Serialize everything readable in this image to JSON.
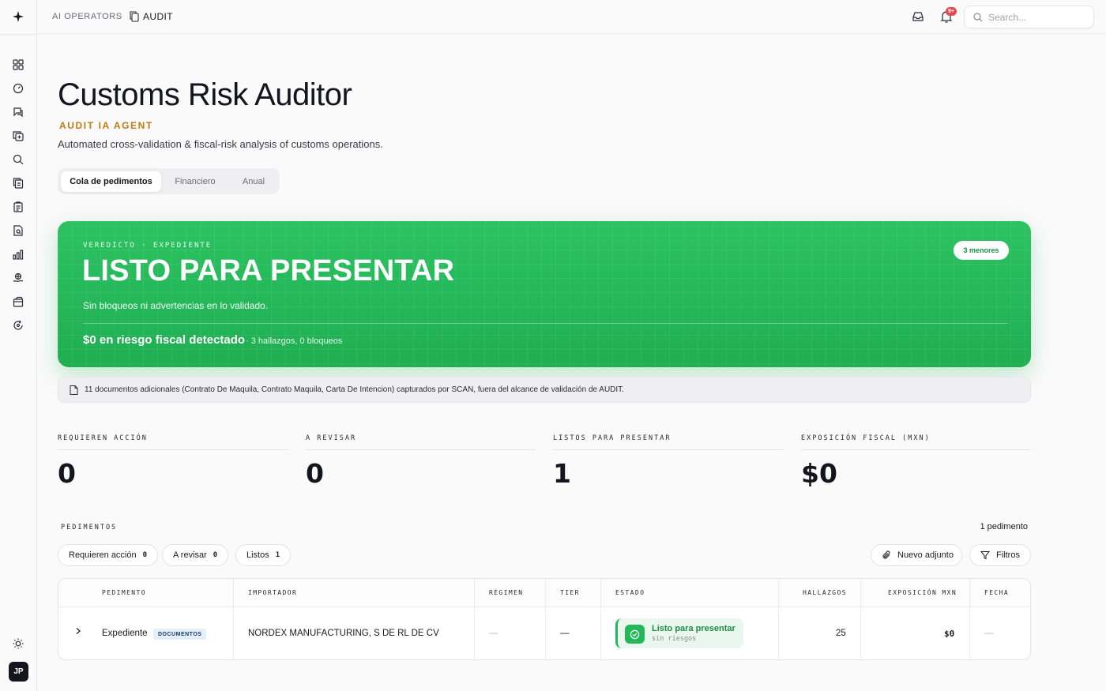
{
  "colors": {
    "accent_green": "#25b85a",
    "accent_orange": "#c27a12",
    "badge_red": "#e5484d"
  },
  "topbar": {
    "breadcrumb_parent": "AI OPERATORS",
    "breadcrumb_sep": "›",
    "breadcrumb_current": "AUDIT",
    "notifications_badge": "9+",
    "search_placeholder": "Search..."
  },
  "sidebar": {
    "icons": [
      "dashboard-icon",
      "gauge-icon",
      "chat-icon",
      "copy-plus-icon",
      "search-doc-icon",
      "documents-icon",
      "clipboard-icon",
      "file-search-icon",
      "bar-chart-icon",
      "globe-hand-icon",
      "package-icon",
      "refresh-icon"
    ],
    "theme_icon": "sun-icon",
    "avatar": "JP"
  },
  "header": {
    "title": "Customs Risk Auditor",
    "subtitle": "AUDIT IA AGENT",
    "description": "Automated cross-validation & fiscal-risk analysis of customs operations."
  },
  "tabs": [
    "Cola de pedimentos",
    "Financiero",
    "Anual"
  ],
  "active_tab": 0,
  "verdict": {
    "eyebrow": "VEREDICTO · EXPEDIENTE",
    "title": "LISTO PARA PRESENTAR",
    "text": "Sin bloqueos ni advertencias en lo validado.",
    "amount": "$0 en riesgo fiscal detectado",
    "meta": "· 3 hallazgos, 0 bloqueos",
    "pill": "3 menores"
  },
  "notice": "11 documentos adicionales (Contrato De Maquila, Contrato Maquila, Carta De Intencion) capturados por SCAN, fuera del alcance de validación de AUDIT.",
  "stats": [
    {
      "label": "REQUIEREN ACCIÓN",
      "value": "0"
    },
    {
      "label": "A REVISAR",
      "value": "0"
    },
    {
      "label": "LISTOS PARA PRESENTAR",
      "value": "1"
    },
    {
      "label": "EXPOSICIÓN FISCAL (MXN)",
      "value": "$0"
    }
  ],
  "pedimentos": {
    "label": "PEDIMENTOS",
    "count": "1 pedimento",
    "filters": [
      {
        "label": "Requieren acción",
        "count": "0"
      },
      {
        "label": "A revisar",
        "count": "0"
      },
      {
        "label": "Listos",
        "count": "1"
      }
    ],
    "new_attachment": "Nuevo adjunto",
    "filters_button": "Filtros"
  },
  "table": {
    "columns": [
      "PEDIMENTO",
      "IMPORTADOR",
      "RÉGIMEN",
      "TIER",
      "ESTADO",
      "HALLAZGOS",
      "EXPOSICIÓN MXN",
      "FECHA"
    ],
    "rows": [
      {
        "pedimento": "Expediente",
        "tag": "DOCUMENTOS",
        "importador": "NORDEX MANUFACTURING, S DE RL DE CV",
        "regimen": "—",
        "tier": "—",
        "estado_title": "Listo para presentar",
        "estado_sub": "sin riesgos",
        "hallazgos": "25",
        "exposicion": "$0",
        "fecha": "—"
      }
    ]
  }
}
